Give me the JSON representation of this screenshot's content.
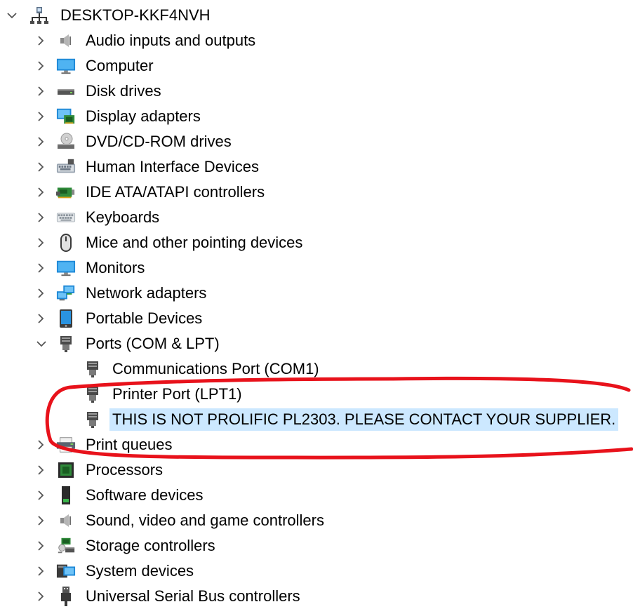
{
  "root": {
    "label": "DESKTOP-KKF4NVH",
    "icon": "computer-network-icon",
    "expanded": true
  },
  "categories": [
    {
      "label": "Audio inputs and outputs",
      "icon": "speaker-icon"
    },
    {
      "label": "Computer",
      "icon": "monitor-icon"
    },
    {
      "label": "Disk drives",
      "icon": "disk-drive-icon"
    },
    {
      "label": "Display adapters",
      "icon": "display-adapter-icon"
    },
    {
      "label": "DVD/CD-ROM drives",
      "icon": "dvd-drive-icon"
    },
    {
      "label": "Human Interface Devices",
      "icon": "hid-icon"
    },
    {
      "label": "IDE ATA/ATAPI controllers",
      "icon": "ide-controller-icon"
    },
    {
      "label": "Keyboards",
      "icon": "keyboard-icon"
    },
    {
      "label": "Mice and other pointing devices",
      "icon": "mouse-icon"
    },
    {
      "label": "Monitors",
      "icon": "monitor-icon"
    },
    {
      "label": "Network adapters",
      "icon": "network-adapter-icon"
    },
    {
      "label": "Portable Devices",
      "icon": "portable-device-icon"
    },
    {
      "label": "Ports (COM & LPT)",
      "icon": "port-icon",
      "expanded": true,
      "children": [
        {
          "label": "Communications Port (COM1)",
          "icon": "port-icon"
        },
        {
          "label": "Printer Port (LPT1)",
          "icon": "port-icon"
        },
        {
          "label": "THIS IS NOT PROLIFIC PL2303. PLEASE CONTACT YOUR SUPPLIER.",
          "icon": "port-icon",
          "selected": true
        }
      ]
    },
    {
      "label": "Print queues",
      "icon": "printer-icon"
    },
    {
      "label": "Processors",
      "icon": "processor-icon"
    },
    {
      "label": "Software devices",
      "icon": "software-device-icon"
    },
    {
      "label": "Sound, video and game controllers",
      "icon": "speaker-icon"
    },
    {
      "label": "Storage controllers",
      "icon": "storage-controller-icon"
    },
    {
      "label": "System devices",
      "icon": "system-devices-icon"
    },
    {
      "label": "Universal Serial Bus controllers",
      "icon": "usb-icon"
    }
  ],
  "colors": {
    "selection": "#cce8ff",
    "annotation": "#e8121b",
    "chevron": "#555555"
  }
}
